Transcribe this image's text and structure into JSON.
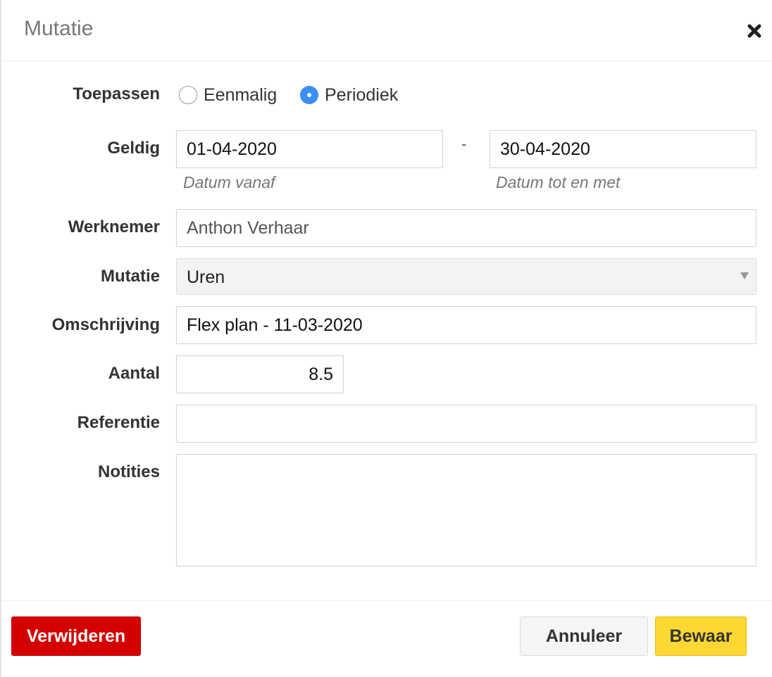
{
  "dialog": {
    "title": "Mutatie",
    "close_icon": "close-icon"
  },
  "form": {
    "toepassen": {
      "label": "Toepassen",
      "options": [
        {
          "label": "Eenmalig",
          "checked": false
        },
        {
          "label": "Periodiek",
          "checked": true
        }
      ]
    },
    "geldig": {
      "label": "Geldig",
      "from_value": "01-04-2020",
      "from_help": "Datum vanaf",
      "separator": "-",
      "to_value": "30-04-2020",
      "to_help": "Datum tot en met"
    },
    "werknemer": {
      "label": "Werknemer",
      "value": "Anthon Verhaar"
    },
    "mutatie": {
      "label": "Mutatie",
      "selected": "Uren"
    },
    "omschrijving": {
      "label": "Omschrijving",
      "value": "Flex plan - 11-03-2020"
    },
    "aantal": {
      "label": "Aantal",
      "value": "8.5"
    },
    "referentie": {
      "label": "Referentie",
      "value": ""
    },
    "notities": {
      "label": "Notities",
      "value": ""
    }
  },
  "footer": {
    "delete_label": "Verwijderen",
    "cancel_label": "Annuleer",
    "save_label": "Bewaar"
  },
  "colors": {
    "radio_checked": "#3b8ff5",
    "delete_button": "#d40000",
    "save_button": "#fdd833"
  }
}
